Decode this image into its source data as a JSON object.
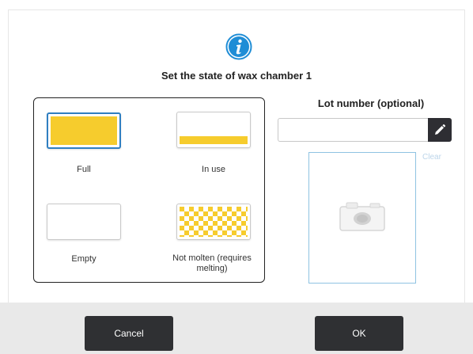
{
  "dialog": {
    "title": "Set the state of wax chamber 1",
    "info_icon": "info-circle-icon"
  },
  "states": {
    "options": [
      {
        "label": "Full",
        "visual": "full",
        "selected": true
      },
      {
        "label": "In use",
        "visual": "partial",
        "selected": false
      },
      {
        "label": "Empty",
        "visual": "empty",
        "selected": false
      },
      {
        "label": "Not molten (requires melting)",
        "visual": "checkered",
        "selected": false
      }
    ]
  },
  "lot": {
    "label": "Lot number (optional)",
    "value": "",
    "edit_icon": "pencil-icon"
  },
  "photo": {
    "icon": "camera-icon",
    "clear_label": "Clear"
  },
  "footer": {
    "cancel_label": "Cancel",
    "ok_label": "OK"
  },
  "colors": {
    "wax_fill": "#f6cc2d",
    "selection_border": "#2f7fc1",
    "button_bg": "#2f3033",
    "footer_bg": "#e9e9e9",
    "info_blue": "#1f8dd6"
  }
}
